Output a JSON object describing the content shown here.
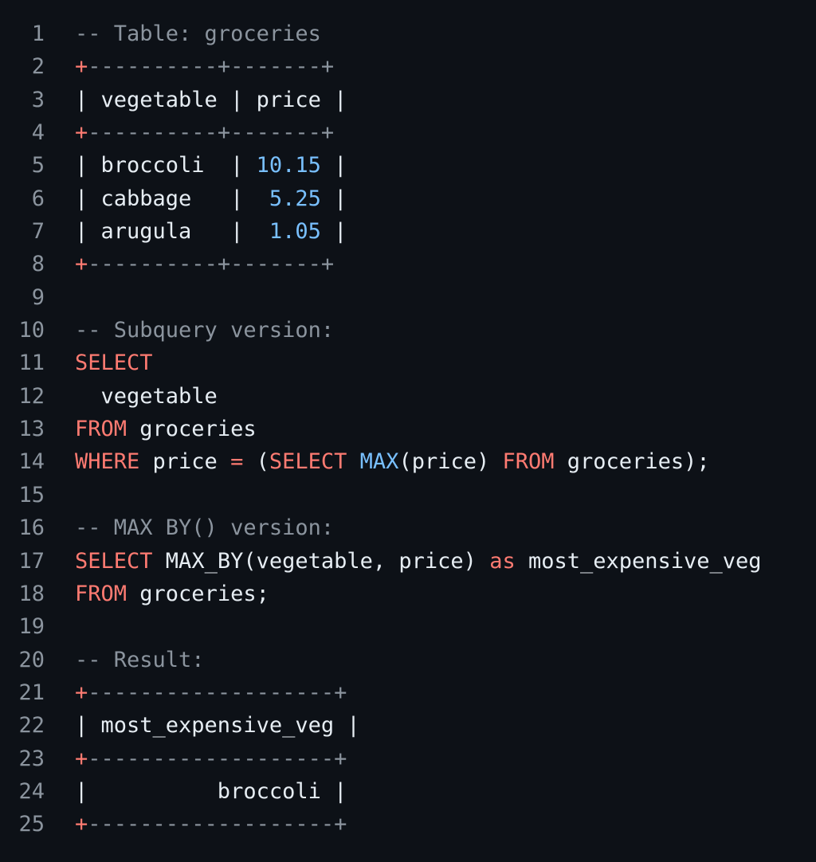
{
  "editor": {
    "lines": [
      {
        "n": "1",
        "tokens": [
          {
            "t": "-- Table: groceries",
            "k": "comment"
          }
        ]
      },
      {
        "n": "2",
        "tokens": [
          {
            "t": "+",
            "k": "border-plus"
          },
          {
            "t": "----------",
            "k": "border-dash"
          },
          {
            "t": "+",
            "k": "border-dash"
          },
          {
            "t": "-------",
            "k": "border-dash"
          },
          {
            "t": "+",
            "k": "border-dash"
          }
        ]
      },
      {
        "n": "3",
        "tokens": [
          {
            "t": "| vegetable | price |",
            "k": "plain"
          }
        ]
      },
      {
        "n": "4",
        "tokens": [
          {
            "t": "+",
            "k": "border-plus"
          },
          {
            "t": "----------",
            "k": "border-dash"
          },
          {
            "t": "+",
            "k": "border-dash"
          },
          {
            "t": "-------",
            "k": "border-dash"
          },
          {
            "t": "+",
            "k": "border-dash"
          }
        ]
      },
      {
        "n": "5",
        "tokens": [
          {
            "t": "| broccoli  | ",
            "k": "plain"
          },
          {
            "t": "10.15",
            "k": "number"
          },
          {
            "t": " |",
            "k": "plain"
          }
        ]
      },
      {
        "n": "6",
        "tokens": [
          {
            "t": "| cabbage   |  ",
            "k": "plain"
          },
          {
            "t": "5.25",
            "k": "number"
          },
          {
            "t": " |",
            "k": "plain"
          }
        ]
      },
      {
        "n": "7",
        "tokens": [
          {
            "t": "| arugula   |  ",
            "k": "plain"
          },
          {
            "t": "1.05",
            "k": "number"
          },
          {
            "t": " |",
            "k": "plain"
          }
        ]
      },
      {
        "n": "8",
        "tokens": [
          {
            "t": "+",
            "k": "border-plus"
          },
          {
            "t": "----------",
            "k": "border-dash"
          },
          {
            "t": "+",
            "k": "border-dash"
          },
          {
            "t": "-------",
            "k": "border-dash"
          },
          {
            "t": "+",
            "k": "border-dash"
          }
        ]
      },
      {
        "n": "9",
        "tokens": []
      },
      {
        "n": "10",
        "tokens": [
          {
            "t": "-- Subquery version:",
            "k": "comment"
          }
        ]
      },
      {
        "n": "11",
        "tokens": [
          {
            "t": "SELECT",
            "k": "keyword"
          }
        ]
      },
      {
        "n": "12",
        "tokens": [
          {
            "t": "  vegetable",
            "k": "plain"
          }
        ]
      },
      {
        "n": "13",
        "tokens": [
          {
            "t": "FROM",
            "k": "keyword"
          },
          {
            "t": " groceries",
            "k": "plain"
          }
        ]
      },
      {
        "n": "14",
        "tokens": [
          {
            "t": "WHERE",
            "k": "keyword"
          },
          {
            "t": " price ",
            "k": "plain"
          },
          {
            "t": "=",
            "k": "keyword"
          },
          {
            "t": " (",
            "k": "plain"
          },
          {
            "t": "SELECT",
            "k": "keyword"
          },
          {
            "t": " ",
            "k": "plain"
          },
          {
            "t": "MAX",
            "k": "func"
          },
          {
            "t": "(price) ",
            "k": "plain"
          },
          {
            "t": "FROM",
            "k": "keyword"
          },
          {
            "t": " groceries);",
            "k": "plain"
          }
        ]
      },
      {
        "n": "15",
        "tokens": []
      },
      {
        "n": "16",
        "tokens": [
          {
            "t": "-- MAX BY() version:",
            "k": "comment"
          }
        ]
      },
      {
        "n": "17",
        "tokens": [
          {
            "t": "SELECT",
            "k": "keyword"
          },
          {
            "t": " MAX_BY(vegetable, price) ",
            "k": "plain"
          },
          {
            "t": "as",
            "k": "keyword"
          },
          {
            "t": " most_expensive_veg",
            "k": "plain"
          }
        ]
      },
      {
        "n": "18",
        "tokens": [
          {
            "t": "FROM",
            "k": "keyword"
          },
          {
            "t": " groceries;",
            "k": "plain"
          }
        ]
      },
      {
        "n": "19",
        "tokens": []
      },
      {
        "n": "20",
        "tokens": [
          {
            "t": "-- Result:",
            "k": "comment"
          }
        ]
      },
      {
        "n": "21",
        "tokens": [
          {
            "t": "+",
            "k": "border-plus"
          },
          {
            "t": "-------------------+",
            "k": "border-dash"
          }
        ]
      },
      {
        "n": "22",
        "tokens": [
          {
            "t": "| most_expensive_veg |",
            "k": "plain"
          }
        ]
      },
      {
        "n": "23",
        "tokens": [
          {
            "t": "+",
            "k": "border-plus"
          },
          {
            "t": "-------------------+",
            "k": "border-dash"
          }
        ]
      },
      {
        "n": "24",
        "tokens": [
          {
            "t": "|          broccoli |",
            "k": "plain"
          }
        ]
      },
      {
        "n": "25",
        "tokens": [
          {
            "t": "+",
            "k": "border-plus"
          },
          {
            "t": "-------------------+",
            "k": "border-dash"
          }
        ]
      }
    ]
  },
  "colors": {
    "background": "#0d1117",
    "line_number": "#8b949e",
    "comment": "#8b949e",
    "keyword": "#ff7b72",
    "function": "#79c0ff",
    "number": "#79c0ff",
    "text": "#e6edf3"
  }
}
